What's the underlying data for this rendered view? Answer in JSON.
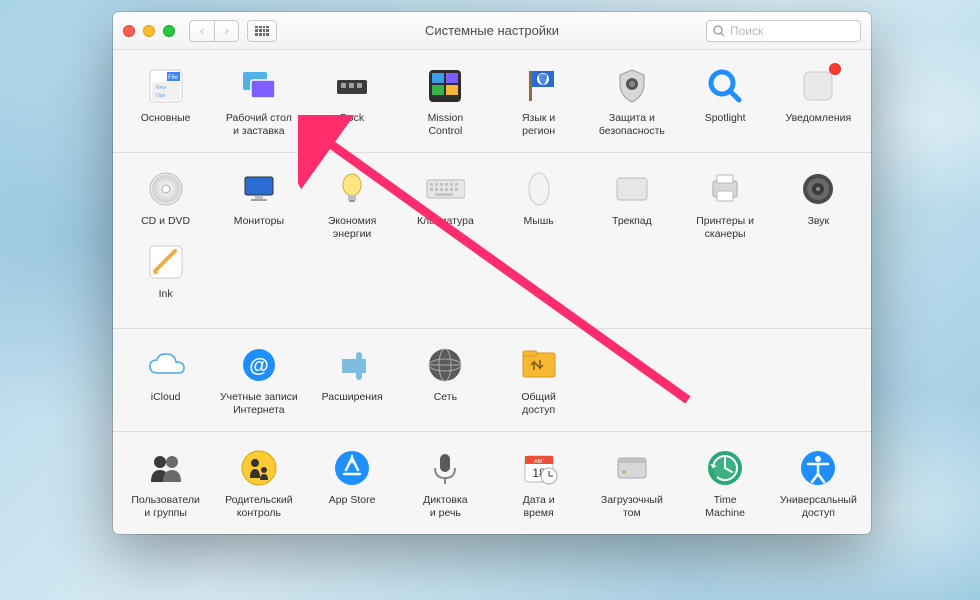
{
  "window": {
    "title": "Системные настройки"
  },
  "search": {
    "placeholder": "Поиск"
  },
  "sections": [
    {
      "items": [
        {
          "id": "general",
          "label": "Основные"
        },
        {
          "id": "desktop",
          "label": "Рабочий стол\nи заставка"
        },
        {
          "id": "dock",
          "label": "Dock"
        },
        {
          "id": "mission-control",
          "label": "Mission\nControl"
        },
        {
          "id": "language",
          "label": "Язык и\nрегион"
        },
        {
          "id": "security",
          "label": "Защита и\nбезопасность"
        },
        {
          "id": "spotlight",
          "label": "Spotlight"
        },
        {
          "id": "notifications",
          "label": "Уведомления",
          "badge": true
        }
      ]
    },
    {
      "items": [
        {
          "id": "cd-dvd",
          "label": "CD и DVD"
        },
        {
          "id": "displays",
          "label": "Мониторы"
        },
        {
          "id": "energy",
          "label": "Экономия\nэнергии"
        },
        {
          "id": "keyboard",
          "label": "Клавиатура"
        },
        {
          "id": "mouse",
          "label": "Мышь"
        },
        {
          "id": "trackpad",
          "label": "Трекпад"
        },
        {
          "id": "printers",
          "label": "Принтеры и\nсканеры"
        },
        {
          "id": "sound",
          "label": "Звук"
        },
        {
          "id": "ink",
          "label": "Ink"
        }
      ]
    },
    {
      "items": [
        {
          "id": "icloud",
          "label": "iCloud"
        },
        {
          "id": "internet-accounts",
          "label": "Учетные записи\nИнтернета"
        },
        {
          "id": "extensions",
          "label": "Расширения"
        },
        {
          "id": "network",
          "label": "Сеть"
        },
        {
          "id": "sharing",
          "label": "Общий\nдоступ"
        }
      ]
    },
    {
      "items": [
        {
          "id": "users",
          "label": "Пользователи\nи группы"
        },
        {
          "id": "parental",
          "label": "Родительский\nконтроль"
        },
        {
          "id": "app-store",
          "label": "App Store"
        },
        {
          "id": "dictation",
          "label": "Диктовка\nи речь"
        },
        {
          "id": "date-time",
          "label": "Дата и\nвремя"
        },
        {
          "id": "startup-disk",
          "label": "Загрузочный\nтом"
        },
        {
          "id": "time-machine",
          "label": "Time\nMachine"
        },
        {
          "id": "accessibility",
          "label": "Универсальный\nдоступ"
        }
      ]
    }
  ],
  "icons": {
    "general": "<svg width='38' height='38'><rect x='3' y='3' width='32' height='32' rx='4' fill='#fff' stroke='#d0d0d0'/><rect x='20' y='5' width='13' height='9' fill='#3a84f7'/><text x='26' y='12' font-size='6' fill='#fff' text-anchor='middle'>File</text><rect x='5' y='15' width='28' height='18' fill='#f0f0f0'/><text x='9' y='22' font-size='5' fill='#6aa6f0'>New</text><text x='9' y='30' font-size='5' fill='#6aa6f0'>Ope</text></svg>",
    "desktop": "<svg width='38' height='38'><rect x='3' y='5' width='24' height='18' rx='2' fill='#4fb3e8'/><rect x='11' y='13' width='24' height='18' rx='2' fill='#7d5fff' stroke='#fff' stroke-width='1.5'/></svg>",
    "dock": "<svg width='40' height='40'><rect x='5' y='14' width='30' height='14' rx='2' fill='#3a3a3a'/><rect x='9' y='17' width='5' height='5' fill='#9e9e9e'/><rect x='17' y='17' width='5' height='5' fill='#9e9e9e'/><rect x='25' y='17' width='5' height='5' fill='#9e9e9e'/></svg>",
    "mission-control": "<svg width='38' height='38'><rect x='3' y='3' width='32' height='32' rx='4' fill='#2e2e2e'/><rect x='6' y='6' width='12' height='10' fill='#3b9de8'/><rect x='20' y='6' width='12' height='10' fill='#7d5fff'/><rect x='6' y='18' width='12' height='10' fill='#36b34a'/><rect x='20' y='18' width='12' height='10' fill='#f7b733'/></svg>",
    "language": "<svg width='38' height='38'><rect x='9' y='4' width='3' height='30' fill='#8a6d3b'/><rect x='12' y='4' width='22' height='16' fill='#2a6bd4'/><circle cx='23' cy='12' r='6' fill='#fff'/><path d='M19 8 Q23 6 27 8 Q27 16 23 18 Q19 16 19 8' fill='#4b8de0'/></svg>",
    "security": "<svg width='40' height='40'><path d='M20 4 L32 9 L32 18 Q32 30 20 36 Q8 30 8 18 L8 9 Z' fill='#d8d8d8' stroke='#999'/><circle cx='20' cy='18' r='6' fill='#555'/><circle cx='20' cy='18' r='3' fill='#888'/></svg>",
    "spotlight": "<svg width='40' height='40'><circle cx='17' cy='17' r='11' fill='none' stroke='#1f8fff' stroke-width='5'/><line x1='25' y1='25' x2='34' y2='34' stroke='#1f8fff' stroke-width='5' stroke-linecap='round'/></svg>",
    "notifications": "<svg width='38' height='38'><rect x='5' y='5' width='28' height='28' rx='6' fill='#e8e8e8' stroke='#ccc'/></svg>",
    "cd-dvd": "<svg width='40' height='40'><circle cx='20' cy='20' r='16' fill='#eaeaea' stroke='#bbb'/><circle cx='20' cy='20' r='14' fill='url(#g1)'/><defs><radialGradient id='g1'><stop offset='0' stop-color='#fff'/><stop offset='1' stop-color='#d0d0d0'/></radialGradient></defs><circle cx='20' cy='20' r='4' fill='#fff' stroke='#aaa'/></svg>",
    "displays": "<svg width='40' height='40'><rect x='6' y='8' width='28' height='18' rx='2' fill='#2a6bd4' stroke='#333'/><rect x='16' y='27' width='8' height='3' fill='#c0c0c0'/><rect x='12' y='30' width='16' height='2' fill='#a0a0a0'/></svg>",
    "energy": "<svg width='40' height='40'><ellipse cx='20' cy='16' rx='9' ry='11' fill='#ffe680' stroke='#d4af37'/><rect x='16' y='26' width='8' height='5' fill='#c0c0c0'/><rect x='17' y='31' width='6' height='2' fill='#999'/></svg>",
    "keyboard": "<svg width='42' height='30'><rect x='2' y='6' width='38' height='18' rx='2' fill='#e6e6e6' stroke='#bbb'/><g fill='#c4c4c4'><rect x='5' y='9' width='3' height='3'/><rect x='10' y='9' width='3' height='3'/><rect x='15' y='9' width='3' height='3'/><rect x='20' y='9' width='3' height='3'/><rect x='25' y='9' width='3' height='3'/><rect x='30' y='9' width='3' height='3'/><rect x='5' y='14' width='3' height='3'/><rect x='10' y='14' width='3' height='3'/><rect x='15' y='14' width='3' height='3'/><rect x='20' y='14' width='3' height='3'/><rect x='25' y='14' width='3' height='3'/><rect x='30' y='14' width='3' height='3'/><rect x='10' y='19' width='18' height='3'/></g></svg>",
    "mouse": "<svg width='30' height='40'><ellipse cx='15' cy='20' rx='10' ry='16' fill='#f4f4f4' stroke='#ccc'/></svg>",
    "trackpad": "<svg width='40' height='32'><rect x='5' y='5' width='30' height='22' rx='3' fill='#e6e6e6' stroke='#bbb'/></svg>",
    "printers": "<svg width='40' height='40'><rect x='8' y='12' width='24' height='16' rx='2' fill='#d8d8d8' stroke='#aaa'/><rect x='12' y='6' width='16' height='8' fill='#fff' stroke='#bbb'/><rect x='12' y='22' width='16' height='10' fill='#fff' stroke='#bbb'/></svg>",
    "sound": "<svg width='40' height='40'><circle cx='20' cy='20' r='15' fill='#4a4a4a'/><circle cx='20' cy='20' r='11' fill='#6a6a6a'/><circle cx='20' cy='20' r='6' fill='#3a3a3a'/><circle cx='20' cy='20' r='2' fill='#888'/></svg>",
    "ink": "<svg width='38' height='38'><rect x='3' y='3' width='32' height='32' rx='4' fill='#fff' stroke='#ccc'/><path d='M8 28 L28 8' stroke='#e8b04a' stroke-width='4' stroke-linecap='round'/><path d='M8 28 L12 30 L6 32 Z' fill='#e8b04a'/></svg>",
    "icloud": "<svg width='42' height='32'><path d='M12 24 Q4 24 4 17 Q4 11 11 11 Q12 5 20 5 Q29 5 30 13 Q38 13 38 19 Q38 24 32 24 Z' fill='#fff' stroke='#4aa8e8' stroke-width='1.5'/></svg>",
    "internet-accounts": "<svg width='40' height='40'><circle cx='20' cy='20' r='16' fill='#1f8fff'/><text x='20' y='27' font-size='20' fill='#fff' text-anchor='middle' font-weight='bold'>@</text></svg>",
    "extensions": "<svg width='40' height='40'><path d='M10 14 h14 v-4 a3 3 0 0 1 6 0 v4 h4 v14 h-4 v4 a3 3 0 0 1-6 0 v-4 h-14 z' fill='#7fbde0'/></svg>",
    "network": "<svg width='40' height='40'><circle cx='20' cy='20' r='16' fill='#5a5a5a'/><ellipse cx='20' cy='20' rx='16' ry='6' fill='none' stroke='#aaa'/><ellipse cx='20' cy='20' rx='6' ry='16' fill='none' stroke='#aaa'/><line x1='4' y1='20' x2='36' y2='20' stroke='#aaa'/></svg>",
    "sharing": "<svg width='38' height='34'><rect x='3' y='5' width='32' height='24' rx='2' fill='#f7b733' stroke='#d49a1f'/><rect x='3' y='3' width='14' height='5' rx='2' fill='#f7b733' stroke='#d49a1f'/><path d='M14 22 L14 14 L11 17 M14 14 L17 17 M20 12 L20 20 L17 17 M20 20 L23 17' stroke='#7a5c12' stroke-width='1.5' fill='none'/></svg>",
    "users": "<svg width='40' height='40'><circle cx='14' cy='14' r='6' fill='#3a3a3a'/><path d='M5 34 Q5 22 14 22 Q23 22 23 34 Z' fill='#3a3a3a'/><circle cx='26' cy='14' r='6' fill='#6a6a6a'/><path d='M17 34 Q17 22 26 22 Q35 22 35 34 Z' fill='#6a6a6a'/></svg>",
    "parental": "<svg width='40' height='40'><circle cx='20' cy='20' r='17' fill='#ffcc33' stroke='#d4a417'/><circle cx='16' cy='15' r='4' fill='#333'/><circle cx='25' cy='22' r='3' fill='#333'/><path d='M11 30 Q11 21 16 21 Q21 21 21 30' fill='#333'/><path d='M21 32 Q21 26 25 26 Q29 26 29 32' fill='#333'/></svg>",
    "app-store": "<svg width='40' height='40'><circle cx='20' cy='20' r='17' fill='#1f8fff'/><path d='M20 8 L20 14 M12 26 L28 26 M14 22 L20 10 L26 22' stroke='#fff' stroke-width='2.5' fill='none' stroke-linecap='round'/></svg>",
    "dictation": "<svg width='40' height='40'><rect x='15' y='6' width='10' height='18' rx='5' fill='#5a5a5a'/><path d='M10 20 Q10 30 20 30 Q30 30 30 20' stroke='#888' stroke-width='2' fill='none'/><line x1='20' y1='30' x2='20' y2='36' stroke='#888' stroke-width='2'/></svg>",
    "date-time": "<svg width='40' height='40'><rect x='6' y='8' width='28' height='26' rx='3' fill='#fff' stroke='#bbb'/><rect x='6' y='8' width='28' height='8' fill='#e8503a'/><text x='20' y='15' font-size='5' fill='#fff' text-anchor='middle'>АВГ</text><text x='20' y='29' font-size='12' fill='#333' text-anchor='middle'>18</text><circle cx='30' cy='28' r='8' fill='#fff' stroke='#aaa'/><line x1='30' y1='28' x2='30' y2='23' stroke='#333'/><line x1='30' y1='28' x2='34' y2='28' stroke='#333'/></svg>",
    "startup-disk": "<svg width='40' height='40'><rect x='6' y='10' width='28' height='20' rx='3' fill='#d8d8d8' stroke='#aaa'/><rect x='6' y='10' width='28' height='5' fill='#c0c0c0'/><circle cx='12' cy='24' r='1.5' fill='#7ac943'/></svg>",
    "time-machine": "<svg width='40' height='40'><circle cx='20' cy='20' r='17' fill='#2aa876'/><circle cx='20' cy='20' r='12' fill='#fff' opacity='.1'/><path d='M20 10 L20 20 L27 24' stroke='#fff' stroke-width='2' fill='none' stroke-linecap='round'/><path d='M8 20 A12 12 0 1 1 12 29' stroke='#fff' stroke-width='2' fill='none'/><path d='M8 20 L5 16 L12 18 Z' fill='#fff'/></svg>",
    "accessibility": "<svg width='40' height='40'><circle cx='20' cy='20' r='17' fill='#1f8fff'/><circle cx='20' cy='11' r='3' fill='#fff'/><path d='M10 16 L30 16 M20 16 L20 26 M20 26 L14 34 M20 26 L26 34' stroke='#fff' stroke-width='2.5' stroke-linecap='round'/></svg>"
  }
}
